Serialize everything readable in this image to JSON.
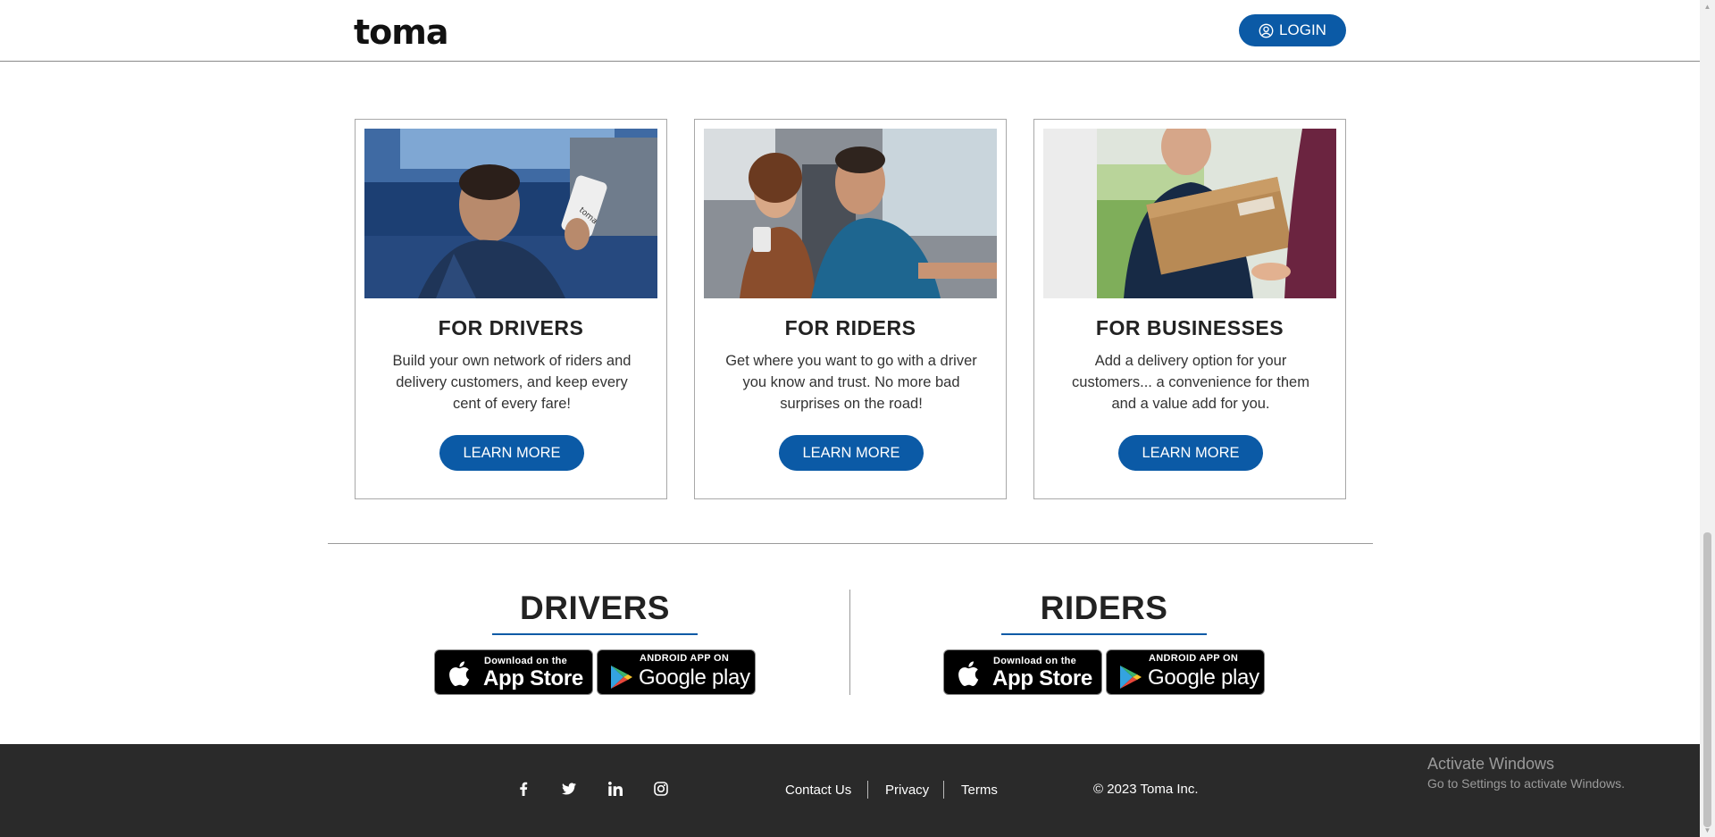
{
  "header": {
    "logo": "toma",
    "login_label": "LOGIN"
  },
  "cards": [
    {
      "title": "FOR DRIVERS",
      "text": "Build your own network of riders and delivery customers, and keep every cent of every fare!",
      "button": "LEARN MORE",
      "phone_text": "toma"
    },
    {
      "title": "FOR RIDERS",
      "text": "Get where you want to go with a driver you know and trust. No more bad surprises on the road!",
      "button": "LEARN MORE"
    },
    {
      "title": "FOR BUSINESSES",
      "text": "Add a delivery option for your customers... a convenience for them and a value add for you.",
      "button": "LEARN MORE"
    }
  ],
  "downloads": {
    "drivers_title": "DRIVERS",
    "riders_title": "RIDERS",
    "app_store": {
      "small": "Download on the",
      "big": "App Store"
    },
    "google_play": {
      "small": "ANDROID APP ON",
      "big": "Google play"
    }
  },
  "footer": {
    "social_icons": [
      "facebook-icon",
      "twitter-icon",
      "linkedin-icon",
      "instagram-icon"
    ],
    "links": [
      "Contact Us",
      "Privacy",
      "Terms"
    ],
    "copyright": "© 2023 Toma Inc."
  },
  "os_watermark": {
    "line1": "Activate Windows",
    "line2": "Go to Settings to activate Windows."
  },
  "colors": {
    "brand_blue": "#0b5aa6",
    "footer_bg": "#2a2a2a"
  }
}
